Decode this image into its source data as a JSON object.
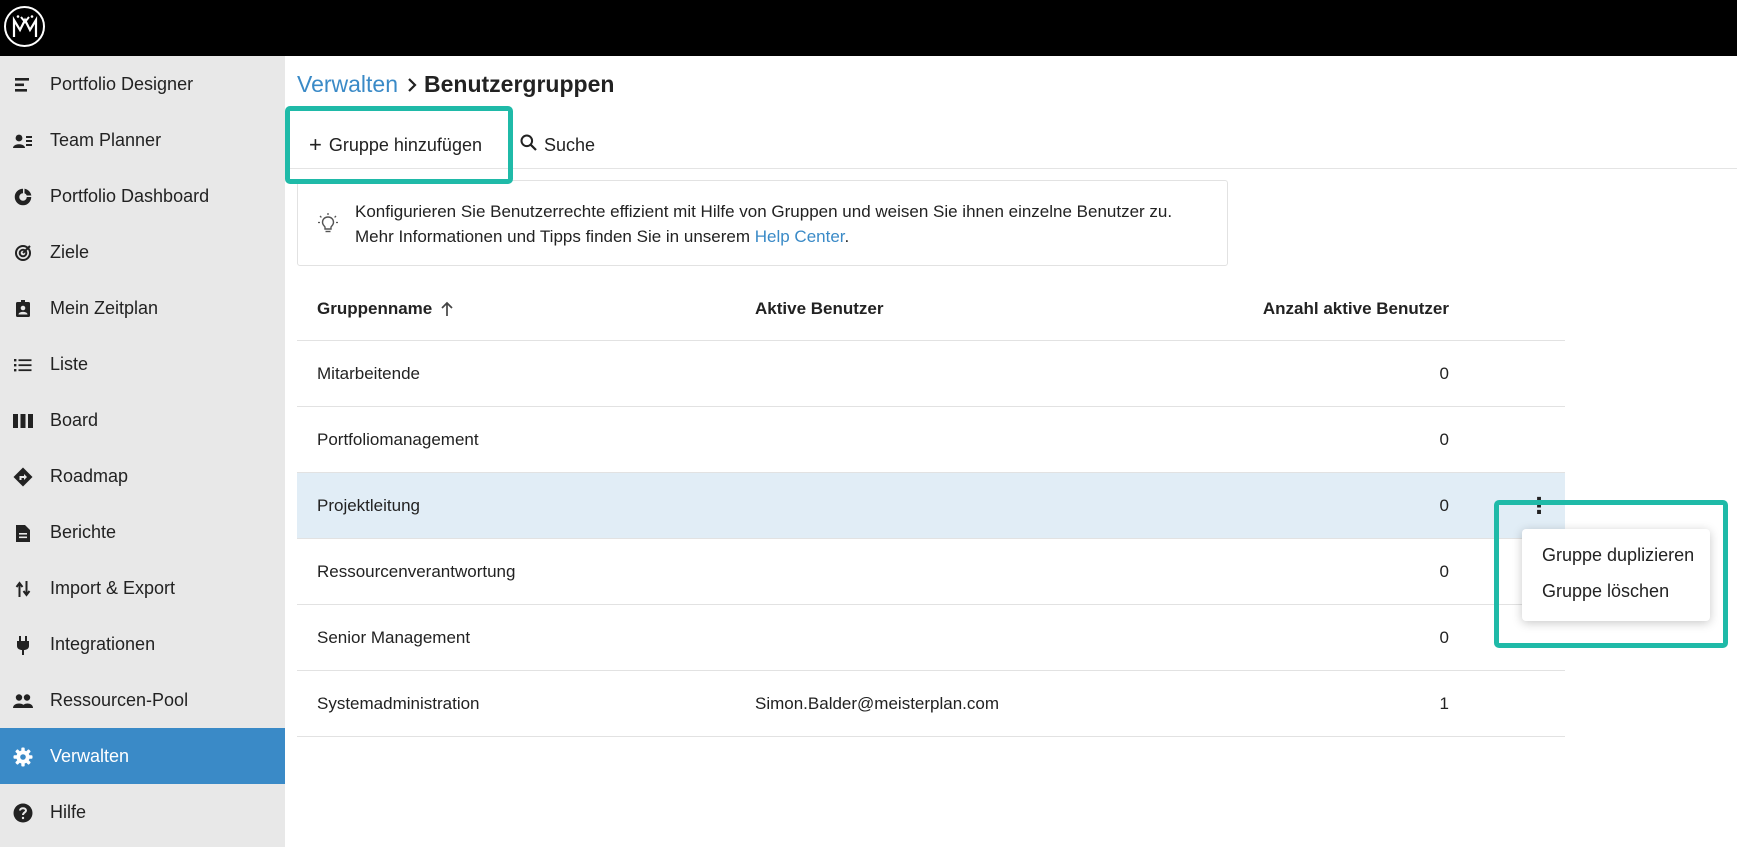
{
  "app": {
    "logo_icon": "meisterplan-logo-icon"
  },
  "sidebar": {
    "active_color": "#3a8ac7",
    "items": [
      {
        "label": "Portfolio Designer",
        "icon": "portfolio-designer-icon"
      },
      {
        "label": "Team Planner",
        "icon": "team-planner-icon"
      },
      {
        "label": "Portfolio Dashboard",
        "icon": "donut-chart-icon"
      },
      {
        "label": "Ziele",
        "icon": "target-icon"
      },
      {
        "label": "Mein Zeitplan",
        "icon": "badge-schedule-icon"
      },
      {
        "label": "Liste",
        "icon": "list-icon"
      },
      {
        "label": "Board",
        "icon": "board-columns-icon"
      },
      {
        "label": "Roadmap",
        "icon": "directions-icon"
      },
      {
        "label": "Berichte",
        "icon": "document-icon"
      },
      {
        "label": "Import & Export",
        "icon": "swap-arrows-icon"
      },
      {
        "label": "Integrationen",
        "icon": "plug-icon"
      },
      {
        "label": "Ressourcen-Pool",
        "icon": "people-icon"
      },
      {
        "label": "Verwalten",
        "icon": "gear-icon",
        "active": true
      },
      {
        "label": "Hilfe",
        "icon": "help-icon"
      }
    ]
  },
  "breadcrumb": {
    "parent": "Verwalten",
    "current": "Benutzergruppen"
  },
  "toolbar": {
    "add_group_label": "Gruppe hinzufügen",
    "search_label": "Suche"
  },
  "info": {
    "line1": "Konfigurieren Sie Benutzerrechte effizient mit Hilfe von Gruppen und weisen Sie ihnen einzelne Benutzer zu.",
    "line2_prefix": "Mehr Informationen und Tipps finden Sie in unserem ",
    "link": "Help Center",
    "line2_suffix": "."
  },
  "table": {
    "headers": {
      "name": "Gruppenname",
      "users": "Aktive Benutzer",
      "count": "Anzahl aktive Benutzer"
    },
    "sort": "ascending",
    "rows": [
      {
        "name": "Mitarbeitende",
        "users": "",
        "count": "0"
      },
      {
        "name": "Portfoliomanagement",
        "users": "",
        "count": "0"
      },
      {
        "name": "Projektleitung",
        "users": "",
        "count": "0",
        "selected": true
      },
      {
        "name": "Ressourcenverantwortung",
        "users": "",
        "count": "0"
      },
      {
        "name": "Senior Management",
        "users": "",
        "count": "0"
      },
      {
        "name": "Systemadministration",
        "users": "Simon.Balder@meisterplan.com",
        "count": "1"
      }
    ]
  },
  "context_menu": {
    "items": [
      "Gruppe duplizieren",
      "Gruppe löschen"
    ]
  },
  "colors": {
    "highlight": "#1fbaa8",
    "selected_row": "#e1edf6",
    "link": "#3a8ac7"
  }
}
